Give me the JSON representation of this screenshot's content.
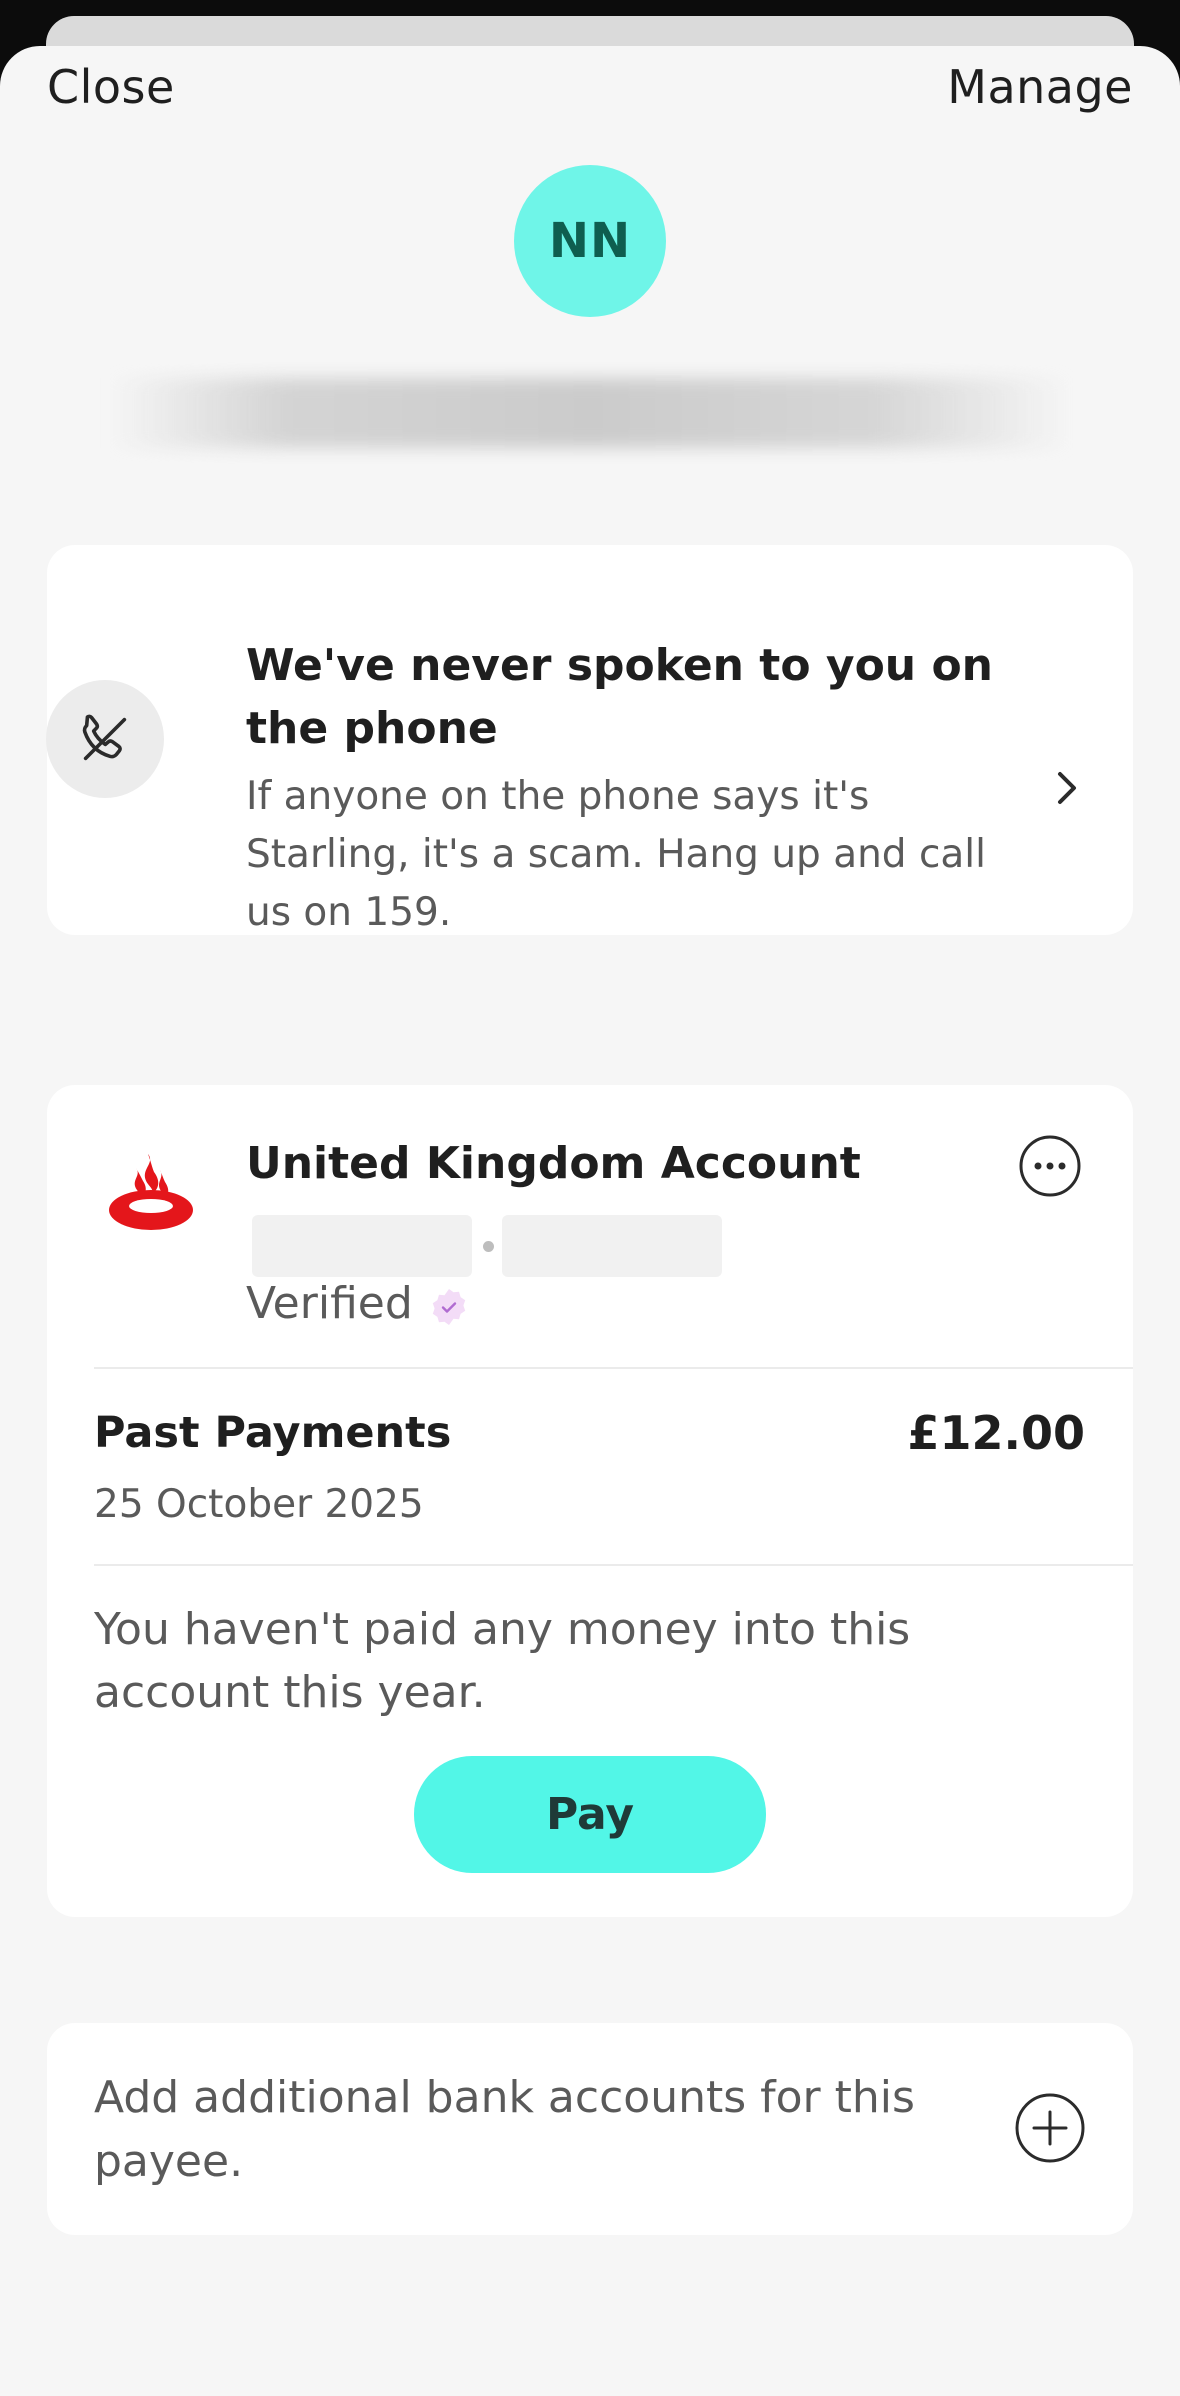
{
  "header": {
    "close_label": "Close",
    "manage_label": "Manage"
  },
  "payee": {
    "initials": "NN",
    "avatar_color": "#6ff5e8"
  },
  "scam_notice": {
    "title": "We've never spoken to you on the phone",
    "body": "If anyone on the phone says it's Starling, it's a scam. Hang up and call us on 159.",
    "icon": "phone-crossed-icon"
  },
  "account": {
    "title": "United Kingdom Account",
    "status": "Verified",
    "bank_logo": "santander-flame-icon",
    "more_icon": "more-options-icon"
  },
  "past_payments": {
    "label": "Past Payments",
    "amount": "£12.00",
    "date": "25 October 2025"
  },
  "pay_section": {
    "message": "You haven't paid any money into this account this year.",
    "pay_label": "Pay",
    "accent": "#52f6e7"
  },
  "add_account": {
    "label": "Add additional bank accounts for this payee.",
    "icon": "plus-circle-icon"
  }
}
